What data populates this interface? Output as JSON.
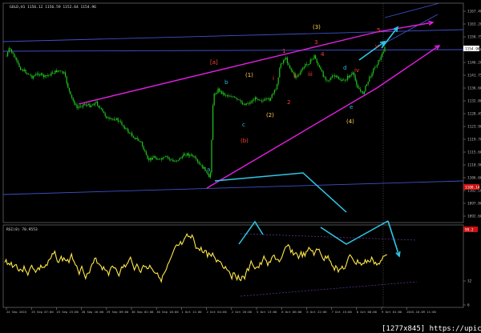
{
  "header": {
    "symbol_info": "GOLD,H1 1156.12 1156.59 1152.64 1154.96"
  },
  "oscillator_header": {
    "name_value": "RSI(8) 70.9553"
  },
  "watermark": "[1277x845] https://upic.me/",
  "price_axis": {
    "ticks": [
      "1167.40",
      "1163.20",
      "1158.75",
      "1150.40",
      "1146.20",
      "1141.75",
      "1136.60",
      "1132.80",
      "1128.45",
      "1123.90",
      "1119.70",
      "1115.60",
      "1110.90",
      "1106.60",
      "1102.10",
      "1097.80",
      "1092.60"
    ],
    "current_price_label": "1154.96",
    "line_price_label": "1108.14"
  },
  "oscillator_axis": {
    "ticks": [
      "100",
      "32",
      "6"
    ],
    "level_label": "99.2"
  },
  "time_axis": {
    "labels": [
      "24 Sep 2015",
      "25 Sep 07:00",
      "25 Sep 23:00",
      "28 Sep 16:00",
      "29 Sep 09:00",
      "30 Sep 02:00",
      "30 Sep 18:00",
      "1 Oct 11:00",
      "2 Oct 04:00",
      "2 Oct 20:00",
      "5 Oct 13:00",
      "6 Oct 06:00",
      "6 Oct 22:00",
      "7 Oct 15:00",
      "8 Oct 08:00",
      "9 Oct 01:00",
      "2015.10.09 11:00"
    ]
  },
  "wave_labels": [
    {
      "text": "[a]",
      "color": "#ff4a2e"
    },
    {
      "text": "(b)",
      "color": "#ff4a2e"
    },
    {
      "text": "(1)",
      "color": "#ffd24a"
    },
    {
      "text": "(2)",
      "color": "#ffd24a"
    },
    {
      "text": "(3)",
      "color": "#ffd24a"
    },
    {
      "text": "(4)",
      "color": "#ffd24a"
    },
    {
      "text": "a",
      "color": "#22b8e6"
    },
    {
      "text": "b",
      "color": "#22b8e6"
    },
    {
      "text": "c",
      "color": "#22b8e6"
    },
    {
      "text": "d",
      "color": "#22b8e6"
    },
    {
      "text": "e",
      "color": "#22b8e6"
    },
    {
      "text": "i",
      "color": "#ff3b3b"
    },
    {
      "text": "ii",
      "color": "#ff3b3b"
    },
    {
      "text": "iii",
      "color": "#ff3b3b"
    },
    {
      "text": "iv",
      "color": "#ff3b3b"
    },
    {
      "text": "v",
      "color": "#ff3b3b"
    },
    {
      "text": "1",
      "color": "#ff3b3b"
    },
    {
      "text": "2",
      "color": "#ff3b3b"
    },
    {
      "text": "3",
      "color": "#ff3b3b"
    },
    {
      "text": "4",
      "color": "#ff3b3b"
    },
    {
      "text": "5",
      "color": "#ff3b3b"
    }
  ],
  "colors": {
    "background": "#000000",
    "candles": "#22c41e",
    "trendline": "#e020e0",
    "channel": "#3f51c8",
    "projection": "#2ec8e8",
    "oscillator": "#ffe84a",
    "axis_text": "#bbbbbb",
    "price_tag": "#ffffff",
    "line_tag": "#cc1111"
  }
}
